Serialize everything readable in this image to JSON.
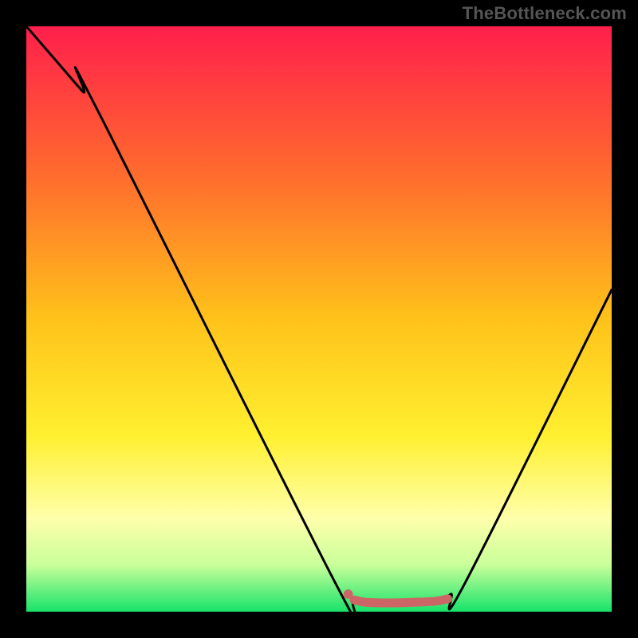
{
  "attribution": "TheBottleneck.com",
  "chart_data": {
    "type": "line",
    "title": "",
    "xlabel": "",
    "ylabel": "",
    "xlim": [
      0,
      100
    ],
    "ylim": [
      0,
      100
    ],
    "grid": false,
    "legend": false,
    "background_gradient": {
      "stops": [
        {
          "offset": 0.0,
          "color": "#ff1f4c"
        },
        {
          "offset": 0.25,
          "color": "#ff6a2e"
        },
        {
          "offset": 0.5,
          "color": "#ffc21a"
        },
        {
          "offset": 0.7,
          "color": "#fff030"
        },
        {
          "offset": 0.84,
          "color": "#ffffaa"
        },
        {
          "offset": 0.92,
          "color": "#c9ff9a"
        },
        {
          "offset": 1.0,
          "color": "#17e36a"
        }
      ]
    },
    "series": [
      {
        "name": "bottleneck-curve",
        "color": "#000000",
        "x": [
          0.0,
          9.5,
          12.0,
          53.0,
          56.0,
          62.0,
          70.0,
          72.5,
          75.0,
          100.0
        ],
        "y": [
          100,
          89.0,
          86.0,
          4.5,
          2.0,
          1.5,
          1.8,
          3.0,
          5.0,
          55.0
        ]
      },
      {
        "name": "optimal-range",
        "color": "#cc6666",
        "style": "thick-rounded",
        "x": [
          56.0,
          58.0,
          62.0,
          66.0,
          70.0,
          72.0
        ],
        "y": [
          2.0,
          1.6,
          1.5,
          1.6,
          1.8,
          2.2
        ]
      }
    ],
    "markers": [
      {
        "name": "optimal-start-dot",
        "x": 55.0,
        "y": 3.0,
        "r": 0.8,
        "color": "#cc6666"
      }
    ]
  }
}
